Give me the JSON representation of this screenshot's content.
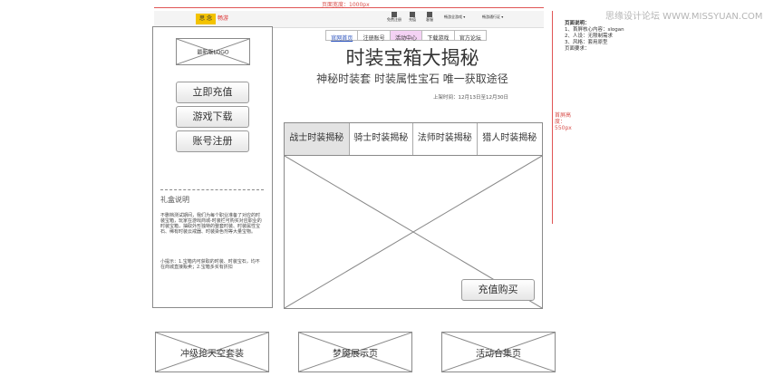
{
  "top_annotation": {
    "width_label": "页面宽度：1000px"
  },
  "header": {
    "logo_text": "思 念",
    "logo_sub": "畅游",
    "icons": [
      {
        "label": "免费注册",
        "icon": "register-icon"
      },
      {
        "label": "充值",
        "icon": "recharge-icon"
      },
      {
        "label": "客服",
        "icon": "service-icon"
      }
    ],
    "dropdowns": [
      "畅游全游戏",
      "畅游通行证"
    ]
  },
  "sidebar": {
    "logo_label": "最新版LOGO",
    "buttons": [
      "立即充值",
      "游戏下载",
      "账号注册"
    ],
    "gift_title": "礼盒说明",
    "gift_desc": "不删档测试期间，我们为每个职业准备了对应的时装宝箱，玩家在游戏商城-时装栏可购买对应职业的时装宝箱，抽取外形独特的整套时装、时装属性宝石、稀有时装云戒器、时装染色剂等大量宝物。",
    "gift_tip": "小提示：1.宝箱内可获取的时装、时装宝石，均不在商城直接贩卖；2.宝箱多买有折扣"
  },
  "main": {
    "nav": [
      "官网首页",
      "注册账号",
      "活动中心",
      "下载游戏",
      "官方论坛"
    ],
    "title": "时装宝箱大揭秘",
    "subtitle": "神秘时装套 时装属性宝石 唯一获取途径",
    "date": "上架时间：12月13日至12月30日",
    "tabs": [
      "战士时装揭秘",
      "骑士时装揭秘",
      "法师时装揭秘",
      "猎人时装揭秘"
    ],
    "buy_button": "充值购买"
  },
  "bottom_links": [
    "冲级抢天空套装",
    "梦魇展示页",
    "活动合集页"
  ],
  "right_notes": {
    "title": "页面说明：",
    "lines": [
      "1、首屏核心内容：slogan",
      "2、人设：无限制需求",
      "3、风格：套用原型",
      "页面要求："
    ],
    "height_label": "首屏高度：550px"
  },
  "watermark": "思缘设计论坛 WWW.MISSYUAN.COM",
  "colors": {
    "accent_red": "#d9534f",
    "tab_active": "#e3e3e3",
    "nav_active": "#f4d2f4"
  }
}
